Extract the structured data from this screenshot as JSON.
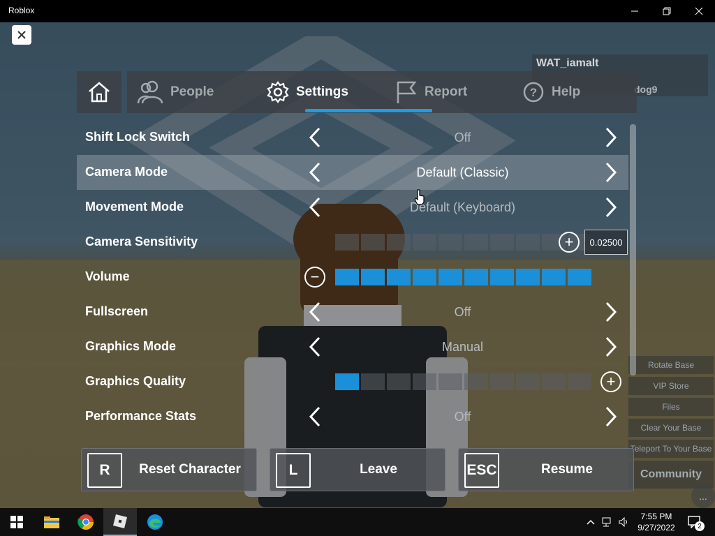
{
  "window": {
    "title": "Roblox",
    "controls": {
      "minimize": "minimize",
      "restore": "restore",
      "close": "close"
    }
  },
  "game": {
    "leaderboard": {
      "user1": "WAT_iamalt",
      "user2": "dog9"
    },
    "side_buttons": [
      "Rotate Base",
      "VIP Store",
      "Files",
      "Clear Your Base",
      "Teleport To Your Base"
    ],
    "community_button": "Community",
    "chat_bubble": "..."
  },
  "tabs": {
    "home_icon": "home-icon",
    "items": [
      {
        "label": "People",
        "icon": "people-icon"
      },
      {
        "label": "Settings",
        "icon": "gear-icon"
      },
      {
        "label": "Report",
        "icon": "flag-icon"
      },
      {
        "label": "Help",
        "icon": "help-icon"
      }
    ],
    "active": "Settings"
  },
  "settings": {
    "shift_lock": {
      "label": "Shift Lock Switch",
      "value": "Off"
    },
    "camera_mode": {
      "label": "Camera Mode",
      "value": "Default (Classic)"
    },
    "movement_mode": {
      "label": "Movement Mode",
      "value": "Default (Keyboard)"
    },
    "camera_sensitivity": {
      "label": "Camera Sensitivity",
      "value": "0.02500",
      "segments_on": 0,
      "segments_total": 10
    },
    "volume": {
      "label": "Volume",
      "segments_on": 10,
      "segments_total": 10
    },
    "fullscreen": {
      "label": "Fullscreen",
      "value": "Off"
    },
    "graphics_mode": {
      "label": "Graphics Mode",
      "value": "Manual"
    },
    "graphics_quality": {
      "label": "Graphics Quality",
      "segments_on": 1,
      "segments_total": 10
    },
    "performance_stats": {
      "label": "Performance Stats",
      "value": "Off"
    }
  },
  "actions": {
    "reset": {
      "key": "R",
      "label": "Reset Character"
    },
    "leave": {
      "key": "L",
      "label": "Leave"
    },
    "resume": {
      "key": "ESC",
      "label": "Resume"
    }
  },
  "taskbar": {
    "apps": [
      "windows-start-icon",
      "file-explorer-icon",
      "chrome-icon",
      "roblox-icon",
      "edge-icon"
    ],
    "time": "7:55 PM",
    "date": "9/27/2022",
    "notification_count": "2"
  },
  "colors": {
    "accent": "#1e9cea",
    "slider_on": "#1b8fd8"
  }
}
